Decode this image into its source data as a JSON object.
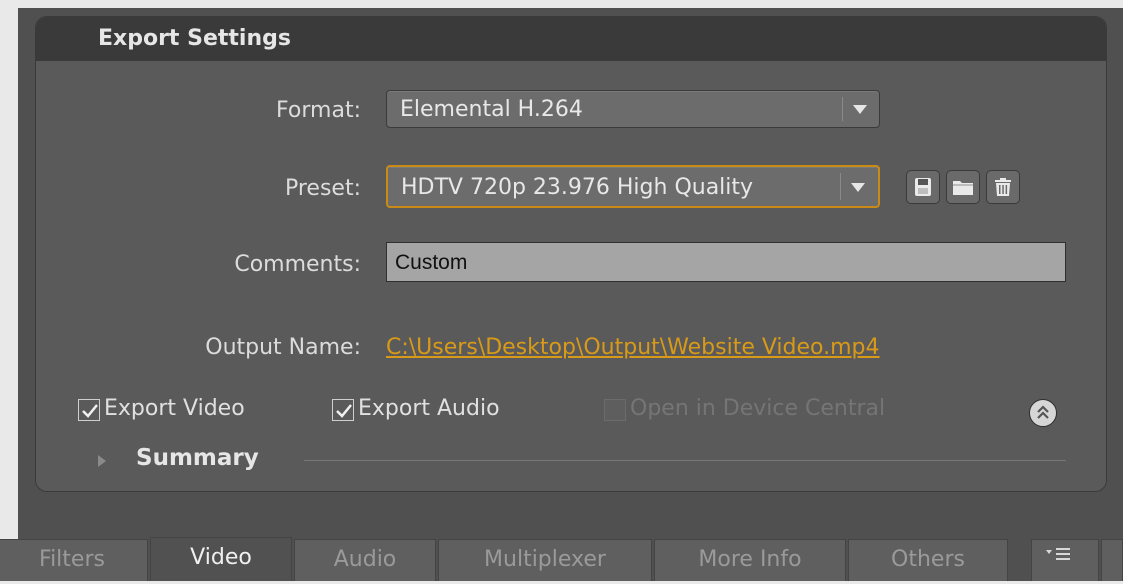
{
  "panel": {
    "title": "Export Settings"
  },
  "format": {
    "label": "Format:",
    "value": "Elemental H.264"
  },
  "preset": {
    "label": "Preset:",
    "value": "HDTV 720p 23.976 High Quality",
    "icons": [
      "save-preset-icon",
      "import-preset-icon",
      "delete-preset-icon"
    ]
  },
  "comments": {
    "label": "Comments:",
    "value": "Custom"
  },
  "output": {
    "label": "Output Name:",
    "value": "C:\\Users\\Desktop\\Output\\Website Video.mp4"
  },
  "options": {
    "export_video": {
      "label": "Export Video",
      "checked": true
    },
    "export_audio": {
      "label": "Export Audio",
      "checked": true
    },
    "device_central": {
      "label": "Open in Device Central",
      "checked": false,
      "enabled": false
    }
  },
  "summary": {
    "label": "Summary"
  },
  "tabs": [
    {
      "label": "Filters",
      "active": false
    },
    {
      "label": "Video",
      "active": true
    },
    {
      "label": "Audio",
      "active": false
    },
    {
      "label": "Multiplexer",
      "active": false
    },
    {
      "label": "More Info",
      "active": false
    },
    {
      "label": "Others",
      "active": false
    }
  ],
  "colors": {
    "accent": "#d99a18",
    "panel": "#575757",
    "header": "#3a3a3a"
  }
}
